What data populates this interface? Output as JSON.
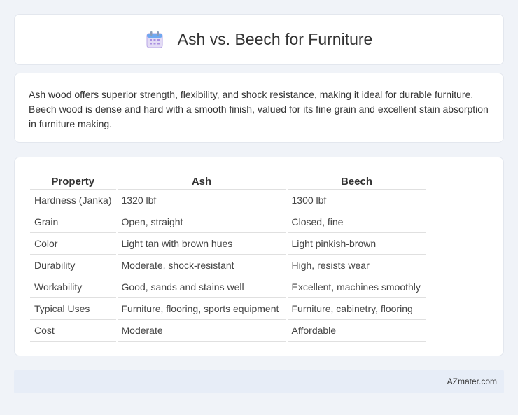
{
  "header": {
    "title": "Ash vs. Beech for Furniture",
    "icon": "calendar-icon"
  },
  "intro": {
    "text": "Ash wood offers superior strength, flexibility, and shock resistance, making it ideal for durable furniture. Beech wood is dense and hard with a smooth finish, valued for its fine grain and excellent stain absorption in furniture making."
  },
  "table": {
    "headers": [
      "Property",
      "Ash",
      "Beech"
    ],
    "rows": [
      [
        "Hardness (Janka)",
        "1320 lbf",
        "1300 lbf"
      ],
      [
        "Grain",
        "Open, straight",
        "Closed, fine"
      ],
      [
        "Color",
        "Light tan with brown hues",
        "Light pinkish-brown"
      ],
      [
        "Durability",
        "Moderate, shock-resistant",
        "High, resists wear"
      ],
      [
        "Workability",
        "Good, sands and stains well",
        "Excellent, machines smoothly"
      ],
      [
        "Typical Uses",
        "Furniture, flooring, sports equipment",
        "Furniture, cabinetry, flooring"
      ],
      [
        "Cost",
        "Moderate",
        "Affordable"
      ]
    ]
  },
  "footer": {
    "text": "AZmater.com"
  }
}
